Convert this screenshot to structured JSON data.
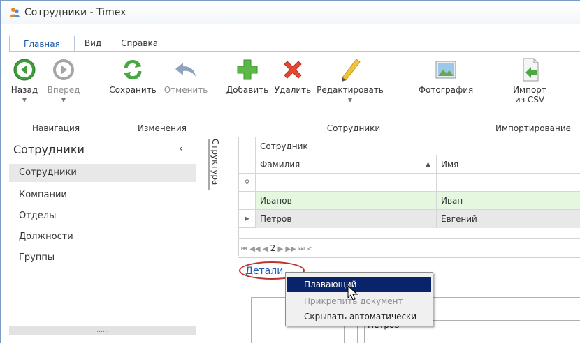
{
  "window": {
    "title": "Сотрудники - Timex"
  },
  "ribbon": {
    "tabs": [
      "Главная",
      "Вид",
      "Справка"
    ],
    "buttons": {
      "back": "Назад",
      "forward": "Вперед",
      "save": "Сохранить",
      "cancel": "Отменить",
      "add": "Добавить",
      "delete": "Удалить",
      "edit": "Редактировать",
      "photo": "Фотография",
      "import_line1": "Импорт",
      "import_line2": "из CSV"
    },
    "groups": {
      "navigation": "Навигация",
      "changes": "Изменения",
      "employees": "Сотрудники",
      "importing": "Импортирование"
    }
  },
  "sidebar": {
    "title": "Сотрудники",
    "items": [
      "Сотрудники",
      "Компании",
      "Отделы",
      "Должности",
      "Группы"
    ],
    "grip": "......"
  },
  "structure_tab": "Структура",
  "grid": {
    "band": "Сотрудник",
    "columns": [
      "Фамилия",
      "Имя"
    ],
    "rows": [
      {
        "last": "Иванов",
        "first": "Иван"
      },
      {
        "last": "Петров",
        "first": "Евгений"
      }
    ],
    "pager": {
      "first": "⏮",
      "prev_page": "◀◀",
      "prev": "◀",
      "current": "2",
      "next": "▶",
      "next_page": "▶▶",
      "last": "⏭",
      "more": "<"
    }
  },
  "details": {
    "title": "Детали",
    "field_value": "Петров"
  },
  "context_menu": {
    "items": [
      "Плавающий",
      "Прикрепить документ",
      "Скрывать автоматически"
    ]
  },
  "colors": {
    "accent": "#1b59a8",
    "highlight": "#0a246a",
    "annotation": "#c0302c"
  }
}
